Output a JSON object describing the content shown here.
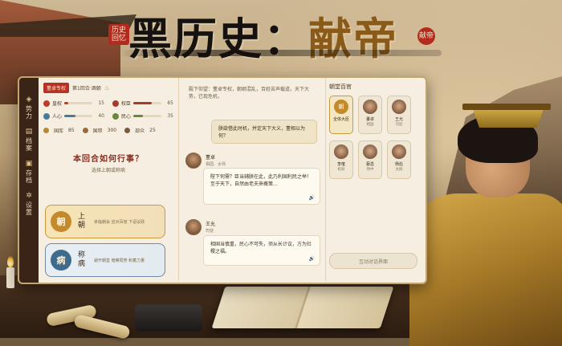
{
  "title": {
    "part1": "黑历史：",
    "part2": "献帝",
    "seal_left": "历史回忆",
    "seal_right": "献帝"
  },
  "sidebar": {
    "items": [
      {
        "label": "势力",
        "icon": "power-icon"
      },
      {
        "label": "档案",
        "icon": "archive-icon"
      },
      {
        "label": "存档",
        "icon": "save-icon"
      },
      {
        "label": "设置",
        "icon": "gear-icon"
      }
    ]
  },
  "status": {
    "tag": "董卓专权",
    "turn": "第1回合·酒朝",
    "marker": "♨"
  },
  "stats": [
    {
      "label": "皇权",
      "value": "15",
      "color": "#c0392b",
      "fill": 0.15
    },
    {
      "label": "权臣",
      "value": "65",
      "color": "#a83a2a",
      "fill": 0.65
    },
    {
      "label": "人心",
      "value": "40",
      "color": "#4a7a9a",
      "fill": 0.4
    },
    {
      "label": "民心",
      "value": "35",
      "color": "#6a8a3a",
      "fill": 0.35
    }
  ],
  "resources": [
    {
      "label": "国库",
      "value": "85",
      "color": "#b58a2e"
    },
    {
      "label": "国帑",
      "value": "300",
      "color": "#9a6a3a"
    },
    {
      "label": "部众",
      "value": "25",
      "color": "#7a5a3a"
    }
  ],
  "question": "本回合如何行事？",
  "question_sub": "选择上朝或称病",
  "actions": {
    "court": {
      "badge": "朝",
      "title": "上朝",
      "desc": "亲临朝会 应对百官 下诏议政"
    },
    "sick": {
      "badge": "病",
      "title": "称病",
      "desc": "避开朝堂 暗察局势 积蓄力量"
    }
  },
  "chat": {
    "narration": "殿下仰望：董卓专权，朝纲混乱，百姓苦声载道，天下大势，已现危机。",
    "user_msg": "朕欲借此时机，并定天下大义，董相以为何？",
    "replies": [
      {
        "name": "董卓",
        "role": "相国、太师",
        "text": "陛下何需？臣当辅朕在此，此乃利国利民之举！至于天下，自然由老夫来概策…",
        "voice": "🔊"
      },
      {
        "name": "王允",
        "role": "司徒",
        "text": "相国当慎重，民心不可失，须从长计议，方为社稷之福。",
        "voice": "🔊"
      }
    ]
  },
  "officials": {
    "title": "朝堂百官",
    "items": [
      {
        "name": "全体大臣",
        "role": "",
        "selected": true,
        "glyph": "朝"
      },
      {
        "name": "董卓",
        "role": "相国",
        "selected": false,
        "glyph": ""
      },
      {
        "name": "王允",
        "role": "司徒",
        "selected": false,
        "glyph": ""
      },
      {
        "name": "李傕",
        "role": "校尉",
        "selected": false,
        "glyph": ""
      },
      {
        "name": "蔡邕",
        "role": "侍中",
        "selected": false,
        "glyph": ""
      },
      {
        "name": "杨彪",
        "role": "太尉",
        "selected": false,
        "glyph": ""
      }
    ],
    "interact_label": "互动对话界面"
  }
}
